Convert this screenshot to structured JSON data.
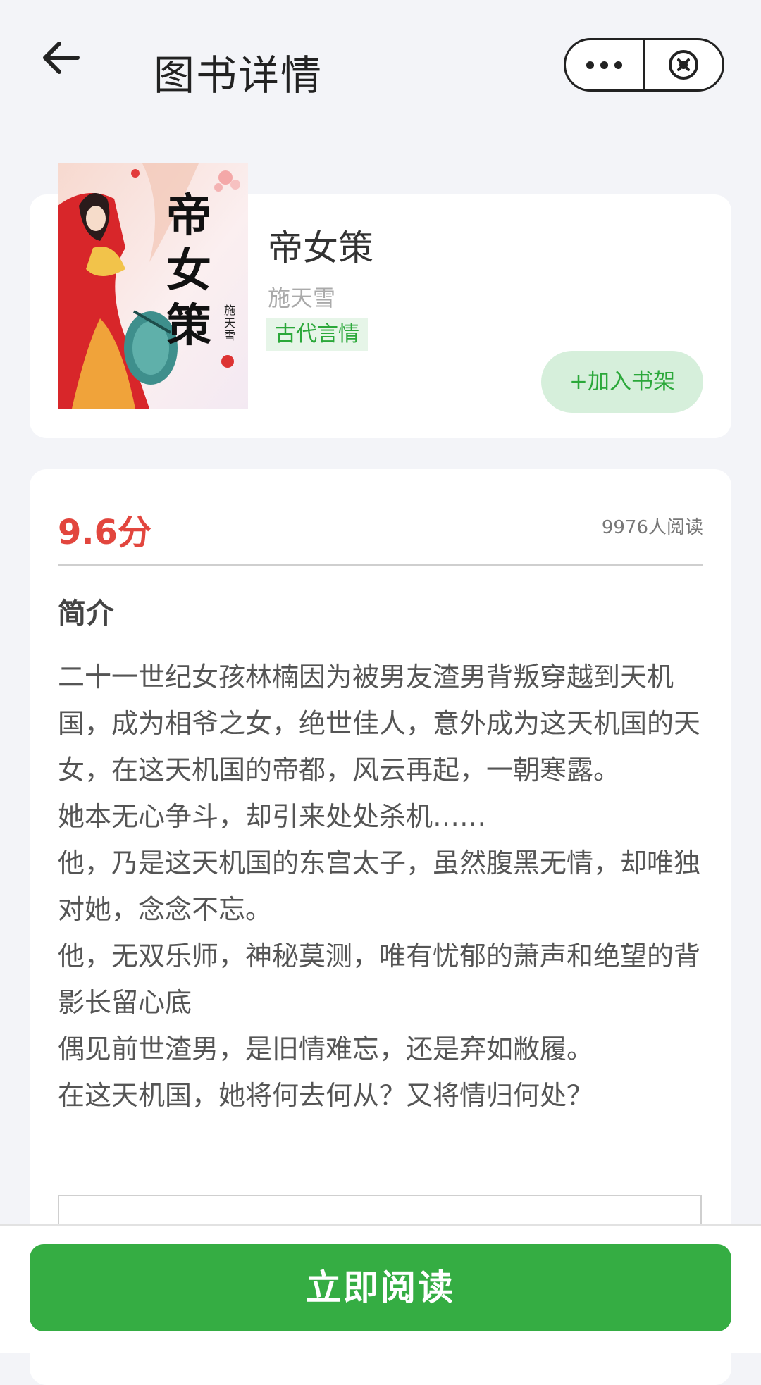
{
  "header": {
    "title": "图书详情"
  },
  "book": {
    "title": "帝女策",
    "author": "施天雪",
    "tag": "古代言情",
    "add_to_shelf": "+加入书架",
    "cover_text": {
      "title_chars": [
        "帝",
        "女",
        "策"
      ],
      "author_vertical": "施天雪"
    }
  },
  "stats": {
    "score": "9.6分",
    "readers": "9976人阅读"
  },
  "intro": {
    "heading": "简介",
    "paragraphs": [
      "二十一世纪女孩林楠因为被男友渣男背叛穿越到天机国，成为相爷之女，绝世佳人，意外成为这天机国的天女，在这天机国的帝都，风云再起，一朝寒露。",
      "她本无心争斗，却引来处处杀机……",
      "他，乃是这天机国的东宫太子，虽然腹黑无情，却唯独对她，念念不忘。",
      "他，无双乐师，神秘莫测，唯有忧郁的萧声和绝望的背影长留心底",
      "偶见前世渣男，是旧情难忘，还是弃如敝履。",
      "在这天机国，她将何去何从？又将情归何处？"
    ]
  },
  "actions": {
    "read_now": "立即阅读"
  },
  "colors": {
    "accent_green": "#35ad43",
    "score_red": "#e2463e",
    "tag_bg": "#e6f5e8"
  }
}
